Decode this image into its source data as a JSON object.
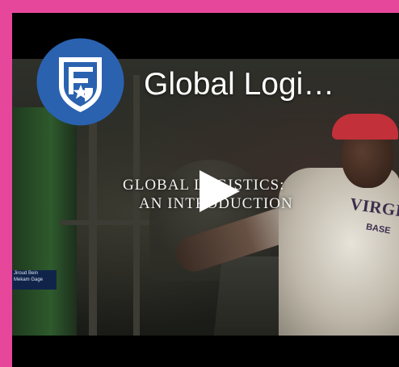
{
  "channel": {
    "title": "Global Logi…"
  },
  "video": {
    "title_line1": "GLOBAL LOGISTICS:",
    "title_line2": "AN INTRODUCTION",
    "banner_line1": "Jiroud Bein",
    "banner_line2": "Mekam Gage",
    "shirt_text": "VIRGIN",
    "shirt_sub": "BASE"
  },
  "icons": {
    "logo": "shield-logo-icon",
    "play": "play-icon"
  },
  "colors": {
    "border": "#e6479b",
    "logo_blue": "#2a62b0",
    "background": "#000000"
  }
}
